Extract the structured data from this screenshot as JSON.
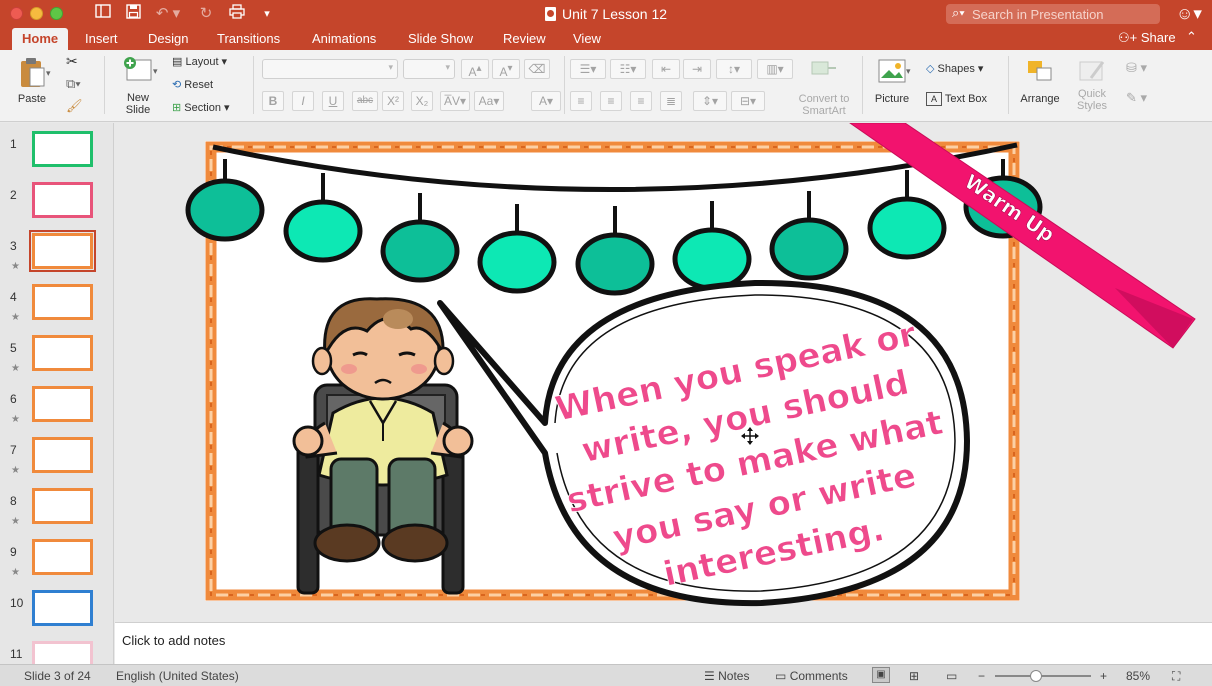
{
  "window": {
    "title": "Unit 7 Lesson 12",
    "search_placeholder": "Search in Presentation"
  },
  "ribbon_tabs": [
    {
      "label": "Home",
      "active": true
    },
    {
      "label": "Insert"
    },
    {
      "label": "Design"
    },
    {
      "label": "Transitions"
    },
    {
      "label": "Animations"
    },
    {
      "label": "Slide Show"
    },
    {
      "label": "Review"
    },
    {
      "label": "View"
    }
  ],
  "share_label": "Share",
  "ribbon": {
    "paste": "Paste",
    "new_slide_line1": "New",
    "new_slide_line2": "Slide",
    "layout": "Layout",
    "reset": "Reset",
    "section": "Section",
    "convert_line1": "Convert to",
    "convert_line2": "SmartArt",
    "picture": "Picture",
    "shapes": "Shapes",
    "text_box": "Text Box",
    "arrange": "Arrange",
    "quick_line1": "Quick",
    "quick_line2": "Styles"
  },
  "thumbnails": [
    {
      "num": "1",
      "starred": false
    },
    {
      "num": "2",
      "starred": false
    },
    {
      "num": "3",
      "starred": true,
      "selected": true
    },
    {
      "num": "4",
      "starred": true
    },
    {
      "num": "5",
      "starred": true
    },
    {
      "num": "6",
      "starred": true
    },
    {
      "num": "7",
      "starred": true
    },
    {
      "num": "8",
      "starred": true
    },
    {
      "num": "9",
      "starred": true
    },
    {
      "num": "10",
      "starred": false
    },
    {
      "num": "11",
      "starred": false
    }
  ],
  "slide": {
    "banner_text": "Warm Up",
    "bubble_lines": [
      "When you speak or",
      "write, you should",
      "strive to make what",
      "you say or write",
      "interesting."
    ],
    "colors": {
      "border_orange": "#f08a3c",
      "bead_dark": "#0dbf98",
      "bead_light": "#0de8b4",
      "banner_pink": "#f2136e",
      "bubble_text": "#ee4a8c"
    }
  },
  "notes_placeholder": "Click to add notes",
  "status": {
    "slide_info": "Slide 3 of 24",
    "language": "English (United States)",
    "notes": "Notes",
    "comments": "Comments",
    "zoom": "85%"
  }
}
